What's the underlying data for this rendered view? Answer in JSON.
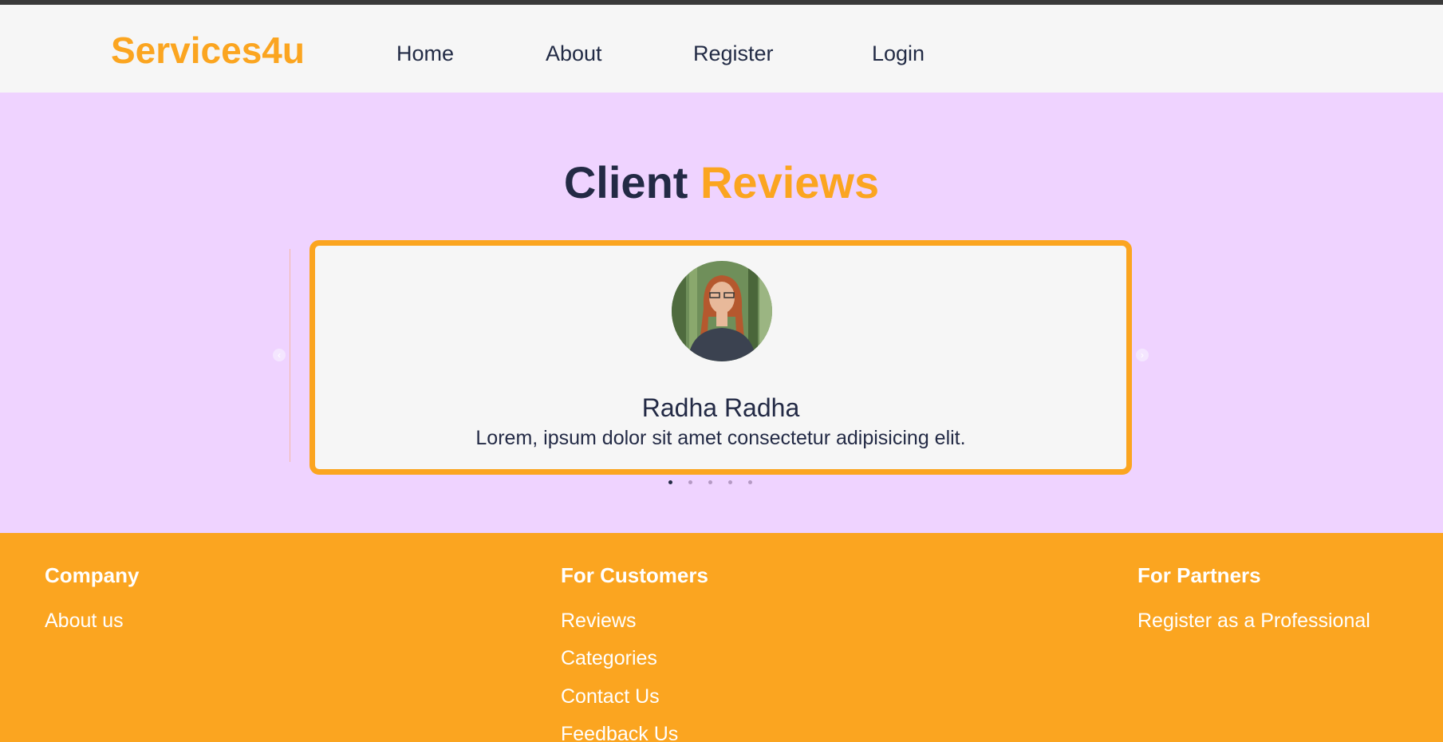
{
  "header": {
    "logo": "Services4u",
    "nav": {
      "home": "Home",
      "about": "About",
      "register": "Register",
      "login": "Login"
    }
  },
  "reviews": {
    "title_part1": "Client",
    "title_part2": "Reviews",
    "prev_icon": "‹",
    "next_icon": "›",
    "current": {
      "name": "Radha Radha",
      "text": "Lorem, ipsum dolor sit amet consectetur adipisicing elit."
    },
    "dot_count": 5,
    "active_dot": 1
  },
  "footer": {
    "company": {
      "heading": "Company",
      "links": [
        "About us"
      ]
    },
    "customers": {
      "heading": "For Customers",
      "links": [
        "Reviews",
        "Categories",
        "Contact Us",
        "Feedback Us"
      ]
    },
    "partners": {
      "heading": "For Partners",
      "links": [
        "Register as a Professional"
      ]
    }
  },
  "colors": {
    "accent": "#fba520",
    "dark": "#232a45",
    "background": "#efd3ff",
    "header_bg": "#f6f6f6"
  }
}
